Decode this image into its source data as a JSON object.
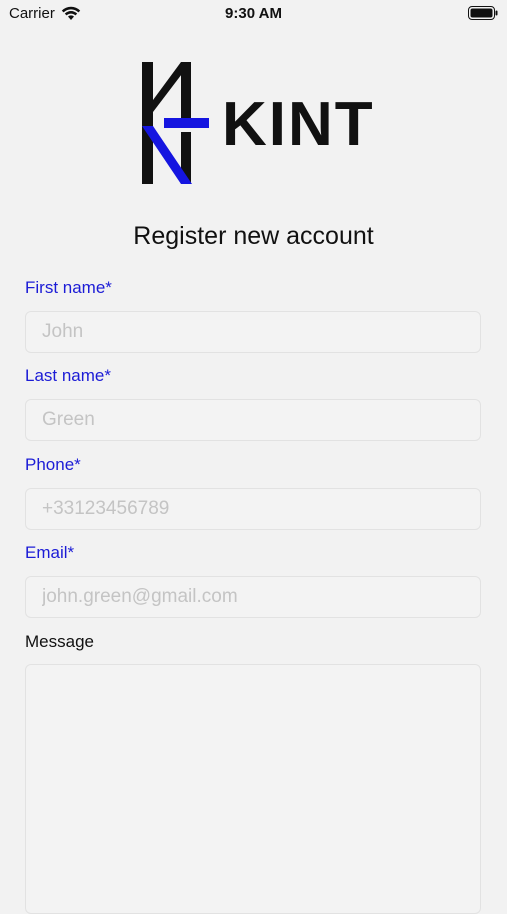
{
  "status_bar": {
    "carrier": "Carrier",
    "time": "9:30 AM",
    "icons": [
      "wifi-icon",
      "battery-icon"
    ]
  },
  "brand": {
    "name": "KINT",
    "accent_color": "#1515e0",
    "label_color": "#1c1cd6"
  },
  "form": {
    "title": "Register new account",
    "fields": [
      {
        "label": "First name*",
        "placeholder": "John"
      },
      {
        "label": "Last name*",
        "placeholder": "Green"
      },
      {
        "label": "Phone*",
        "placeholder": "+33123456789"
      },
      {
        "label": "Email*",
        "placeholder": "john.green@gmail.com"
      }
    ],
    "message": {
      "label": "Message",
      "placeholder": ""
    }
  }
}
